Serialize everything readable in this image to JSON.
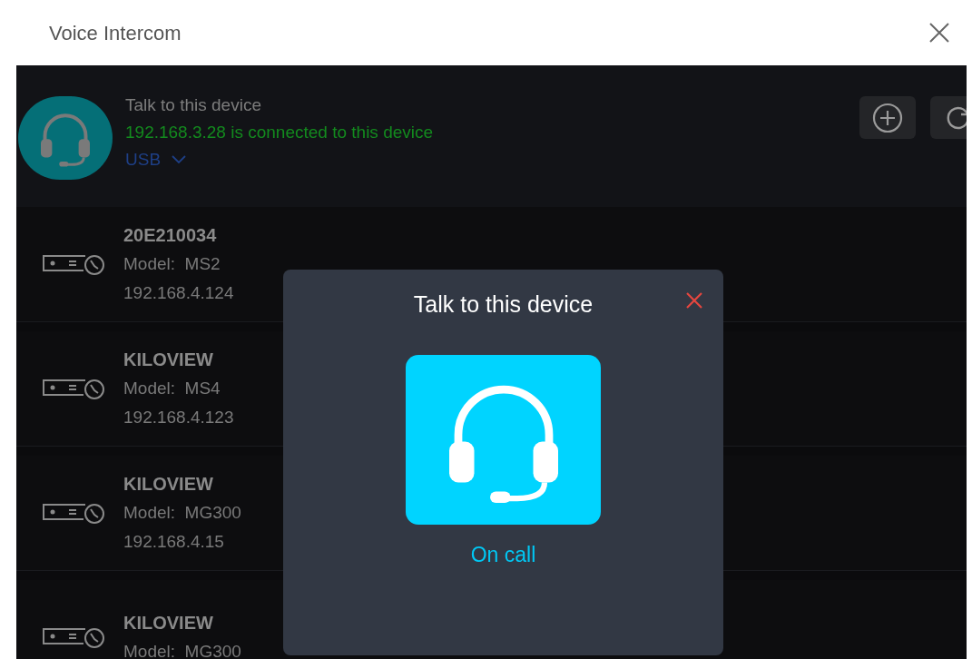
{
  "window": {
    "title": "Voice Intercom"
  },
  "intercom": {
    "title": "Talk to this device",
    "status": "192.168.3.28 is connected to this device",
    "source": "USB"
  },
  "devices": [
    {
      "name": "20E210034",
      "model": "Model:  MS2",
      "ip": "192.168.4.124"
    },
    {
      "name": "KILOVIEW",
      "model": "Model:  MS4",
      "ip": "192.168.4.123"
    },
    {
      "name": "KILOVIEW",
      "model": "Model:  MG300",
      "ip": "192.168.4.15"
    },
    {
      "name": "KILOVIEW",
      "model": "Model:  MG300"
    }
  ],
  "dialog": {
    "title": "Talk to this device",
    "status": "On call"
  }
}
